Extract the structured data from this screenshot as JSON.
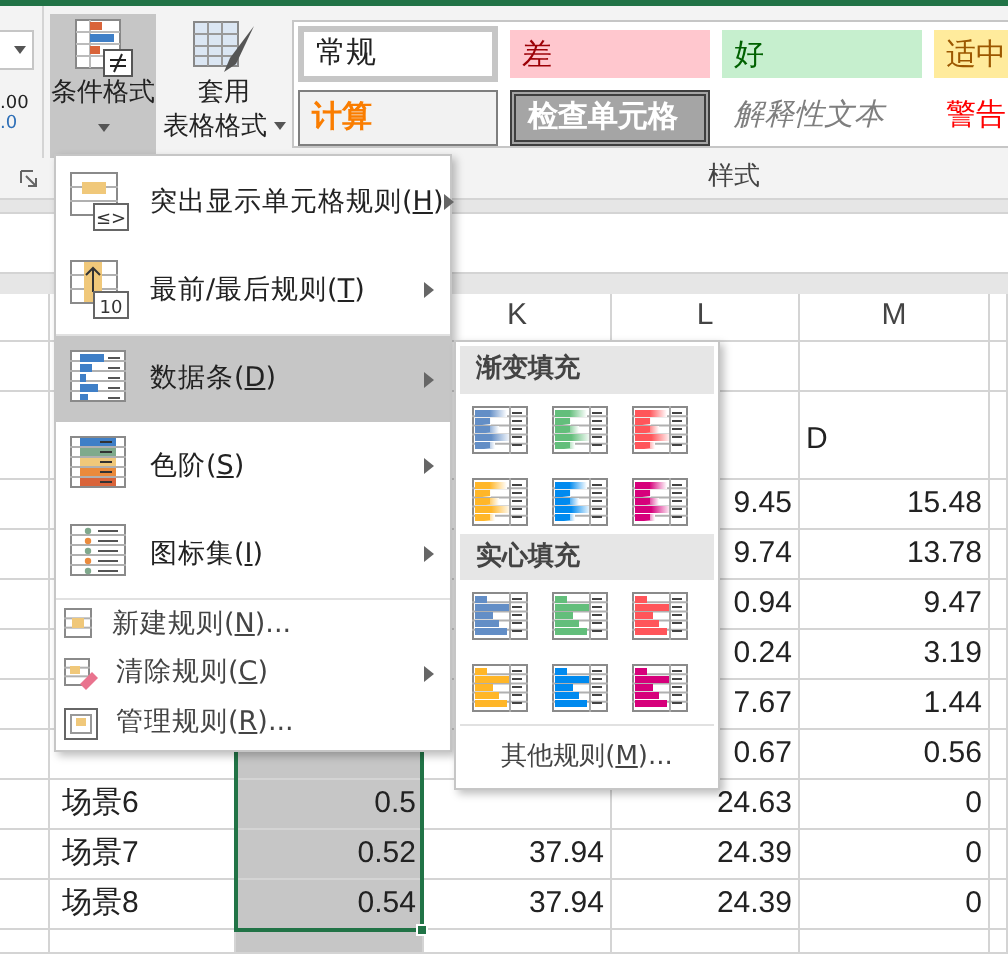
{
  "ribbon": {
    "left_cut": {
      "decimal_top": ".00",
      "decimal_bottom": ".0"
    },
    "buttons": [
      {
        "kind": "conditional_format",
        "lines": [
          "条件格式"
        ],
        "pressed": true
      },
      {
        "kind": "table_format",
        "lines": [
          "套用",
          "表格格式"
        ],
        "pressed": false
      }
    ],
    "styles": [
      {
        "label": "常规",
        "kind": "normal"
      },
      {
        "label": "差",
        "kind": "bad"
      },
      {
        "label": "好",
        "kind": "good"
      },
      {
        "label": "适中",
        "kind": "neutral"
      },
      {
        "label": "计算",
        "kind": "calculation"
      },
      {
        "label": "检查单元格",
        "kind": "check"
      },
      {
        "label": "解释性文本",
        "kind": "explanatory"
      },
      {
        "label": "警告",
        "kind": "warning"
      }
    ],
    "group_label": "样式"
  },
  "sheet": {
    "columns": [
      {
        "selected": false
      },
      {
        "selected": true
      },
      {
        "header": "K",
        "selected": false
      },
      {
        "header": "L",
        "selected": false
      },
      {
        "header": "M",
        "selected": false
      }
    ],
    "rows": [
      {
        "kind": "normal",
        "cells": [
          null,
          null,
          null,
          null,
          null
        ]
      },
      {
        "kind": "tall",
        "cells": [
          null,
          null,
          null,
          null,
          "D"
        ]
      },
      {
        "kind": "normal",
        "cells": [
          null,
          null,
          null,
          "9.45",
          "15.48"
        ]
      },
      {
        "kind": "normal",
        "cells": [
          null,
          null,
          null,
          "9.74",
          "13.78"
        ]
      },
      {
        "kind": "normal",
        "cells": [
          null,
          null,
          null,
          "0.94",
          "9.47"
        ]
      },
      {
        "kind": "normal",
        "cells": [
          null,
          null,
          null,
          "0.24",
          "3.19"
        ]
      },
      {
        "kind": "normal",
        "cells": [
          null,
          null,
          null,
          "7.67",
          "1.44"
        ]
      },
      {
        "kind": "normal",
        "cells": [
          null,
          null,
          null,
          "0.67",
          "0.56"
        ]
      },
      {
        "kind": "normal",
        "cells": [
          "场景6",
          "0.5",
          null,
          "24.63",
          "0"
        ]
      },
      {
        "kind": "normal",
        "cells": [
          "场景7",
          "0.52",
          "37.94",
          "24.39",
          "0"
        ]
      },
      {
        "kind": "normal",
        "cells": [
          "场景8",
          "0.54",
          "37.94",
          "24.39",
          "0"
        ]
      },
      {
        "kind": "partial",
        "cells": [
          null,
          null,
          null,
          null,
          null
        ]
      }
    ]
  },
  "menu": {
    "items": [
      {
        "kind": "large",
        "badge": "≤>",
        "before": "突出显示单元格规则(",
        "key": "H",
        "after": ")",
        "submenu": true,
        "selected": false,
        "separator_before": false
      },
      {
        "kind": "large",
        "badge": "10",
        "before": "最前/最后规则(",
        "key": "T",
        "after": ")",
        "submenu": true,
        "selected": false,
        "separator_before": false
      },
      {
        "kind": "large",
        "before": "数据条(",
        "key": "D",
        "after": ")",
        "submenu": true,
        "selected": true,
        "separator_before": true
      },
      {
        "kind": "large",
        "before": "色阶(",
        "key": "S",
        "after": ")",
        "submenu": true,
        "selected": false,
        "separator_before": false
      },
      {
        "kind": "large",
        "before": "图标集(",
        "key": "I",
        "after": ")",
        "submenu": true,
        "selected": false,
        "separator_before": false
      },
      {
        "kind": "small",
        "before": "新建规则(",
        "key": "N",
        "after": ")...",
        "submenu": false,
        "selected": false,
        "separator_before": true
      },
      {
        "kind": "small",
        "before": "清除规则(",
        "key": "C",
        "after": ")",
        "submenu": true,
        "selected": false,
        "separator_before": false
      },
      {
        "kind": "small",
        "before": "管理规则(",
        "key": "R",
        "after": ")...",
        "submenu": false,
        "selected": false,
        "separator_before": false
      }
    ]
  },
  "submenu": {
    "groups": [
      {
        "title": "渐变填充",
        "kind": "gradient",
        "items": [
          {
            "color": "#638ec6"
          },
          {
            "color": "#63be7b"
          },
          {
            "color": "#ff555a"
          },
          {
            "color": "#ffb628"
          },
          {
            "color": "#008aef"
          },
          {
            "color": "#d6007b"
          }
        ]
      },
      {
        "title": "实心填充",
        "kind": "solid",
        "items": [
          {
            "color": "#638ec6"
          },
          {
            "color": "#63be7b"
          },
          {
            "color": "#ff555a"
          },
          {
            "color": "#ffb628"
          },
          {
            "color": "#008aef"
          },
          {
            "color": "#d6007b"
          }
        ]
      }
    ],
    "more": {
      "before": "其他规则(",
      "key": "M",
      "after": ")..."
    }
  }
}
